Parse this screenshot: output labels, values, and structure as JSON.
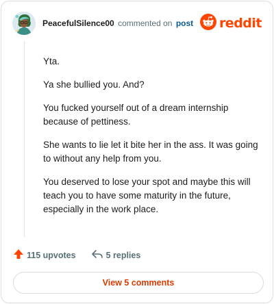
{
  "header": {
    "username": "PeacefulSilence00",
    "action_text": "commented on",
    "post_link": "post",
    "brand": "reddit"
  },
  "comment": {
    "paragraphs": [
      "Yta.",
      "Ya she bullied you. And?",
      "You fucked yourself out of a dream internship because of pettiness.",
      "She wants to lie let it bite her in the ass. It was going to without any help from you.",
      "You deserved to lose your spot and maybe this will teach you to have some maturity in the future, especially in the work place."
    ]
  },
  "actions": {
    "upvotes": "115 upvotes",
    "replies": "5 replies"
  },
  "footer": {
    "view_comments": "View 5 comments"
  },
  "colors": {
    "accent": "#ff4500",
    "link": "#0a5a8f",
    "button_text": "#d93a00"
  }
}
